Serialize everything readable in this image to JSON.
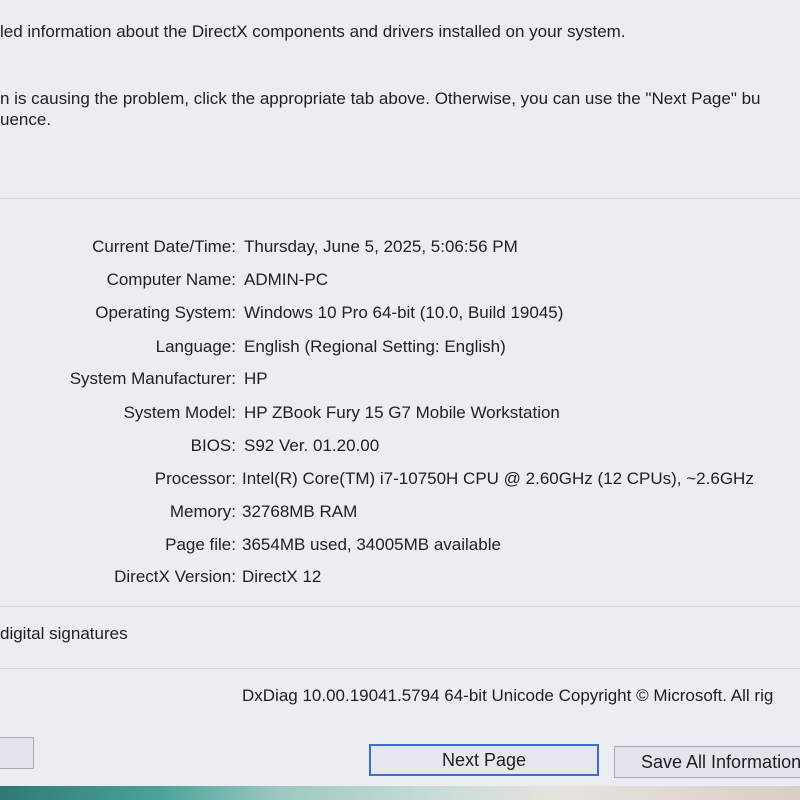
{
  "intro": {
    "line1": "led information about the DirectX components and drivers installed on your system.",
    "line2": "n is causing the problem, click the appropriate tab above.  Otherwise, you can use the \"Next Page\" bu",
    "line3": "uence."
  },
  "system_info": [
    {
      "label": "Current Date/Time:",
      "value": "Thursday, June 5, 2025, 5:06:56 PM"
    },
    {
      "label": "Computer Name:",
      "value": "ADMIN-PC"
    },
    {
      "label": "Operating System:",
      "value": "Windows 10 Pro 64-bit (10.0, Build 19045)"
    },
    {
      "label": "Language:",
      "value": "English (Regional Setting: English)"
    },
    {
      "label": "System Manufacturer:",
      "value": "HP"
    },
    {
      "label": "System Model:",
      "value": "HP ZBook Fury 15 G7 Mobile Workstation"
    },
    {
      "label": "BIOS:",
      "value": "S92 Ver. 01.20.00"
    },
    {
      "label": "Processor:",
      "value": "Intel(R) Core(TM) i7-10750H CPU @ 2.60GHz (12 CPUs), ~2.6GHz"
    },
    {
      "label": "Memory:",
      "value": "32768MB RAM"
    },
    {
      "label": "Page file:",
      "value": "3654MB used, 34005MB available"
    },
    {
      "label": "DirectX Version:",
      "value": "DirectX 12"
    }
  ],
  "whql_check": {
    "label": "digital signatures"
  },
  "footer": {
    "version": "DxDiag 10.00.19041.5794 64-bit Unicode  Copyright © Microsoft. All rig"
  },
  "buttons": {
    "left_label": "",
    "next_page": "Next Page",
    "save_all": "Save All Information"
  }
}
